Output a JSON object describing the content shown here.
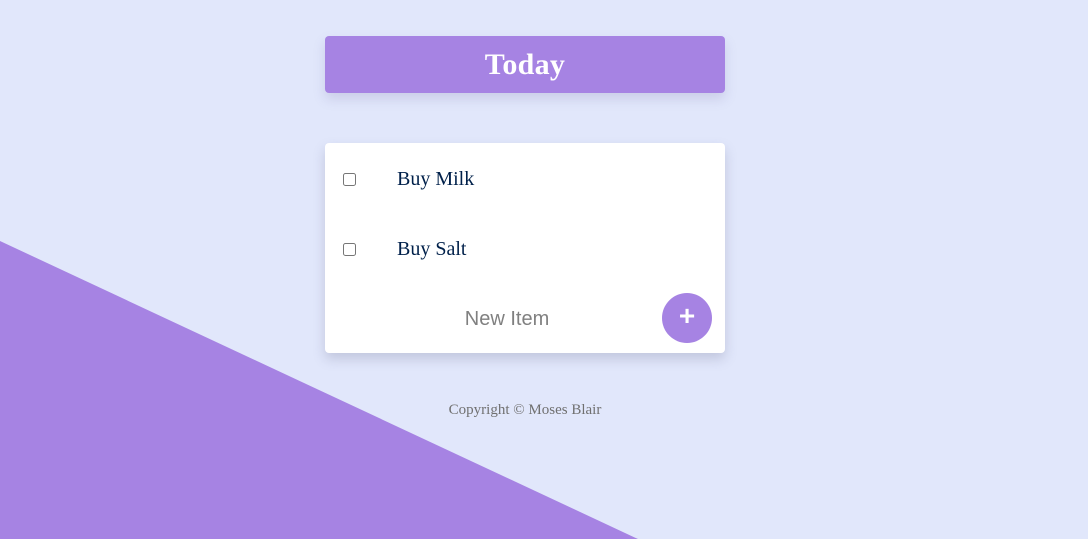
{
  "heading": {
    "title": "Today"
  },
  "todo_list": {
    "items": [
      {
        "label": "Buy Milk",
        "checked": false
      },
      {
        "label": "Buy Salt",
        "checked": false
      }
    ],
    "new_item": {
      "placeholder": "New Item",
      "value": ""
    },
    "add_button_label": "+"
  },
  "footer": {
    "copyright": "Copyright © Moses Blair"
  },
  "colors": {
    "background": "#E1E7FB",
    "accent": "#A683E3",
    "card": "#FFFFFF",
    "item_text": "#00204A",
    "footer_text": "#707070"
  }
}
